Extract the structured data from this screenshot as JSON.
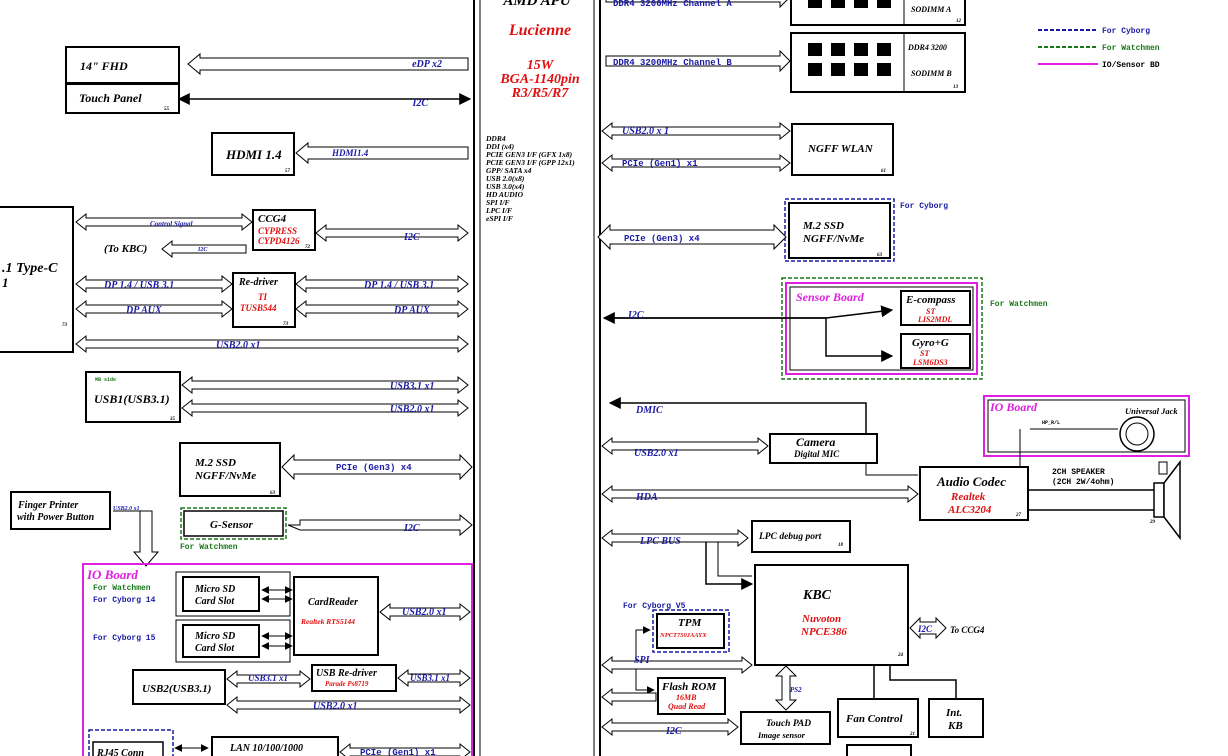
{
  "apu": {
    "title": "AMD APU",
    "codename": "Lucienne",
    "spec_lines": [
      "15W",
      "BGA-1140pin",
      "R3/R5/R7"
    ],
    "interfaces": [
      "DDR4",
      "DDI (x4)",
      "PCIE GEN3 I/F (GFX 1x8)",
      "PCIE GEN3 I/F (GPP 12x1)",
      "GPP/ SATA x4",
      "USB 2.0(x8)",
      "USB 3.0(x4)",
      "HD AUDIO",
      "SPI I/F",
      "LPC I/F",
      "eSPI I/F"
    ]
  },
  "legend": {
    "items": [
      {
        "label": "For Cyborg",
        "color": "#1a1aa6"
      },
      {
        "label": "For Watchmen",
        "color": "#1a7a1a"
      },
      {
        "label": "IO/Sensor BD",
        "color": "#e020e0"
      }
    ]
  },
  "left": {
    "fhd": {
      "title": "14\" FHD",
      "bus": "eDP x2"
    },
    "touch": {
      "title": "Touch Panel",
      "num": "55",
      "bus": "I2C"
    },
    "hdmi": {
      "title": "HDMI 1.4",
      "num": "57",
      "bus": "HDMI1.4"
    },
    "typec": {
      "line1": ".1  Type-C",
      "line2": "1",
      "num": "73"
    },
    "ccg4": {
      "title": "CCG4",
      "vendor": "CYPRESS",
      "part": "CYPD4126",
      "num": "72",
      "bus": "I2C",
      "control": "Control Signal",
      "kbc_label": "(To KBC)",
      "kbc_bus": "I2C"
    },
    "redriver": {
      "title": "Re-driver",
      "vendor": "TI",
      "part": "TUSB544",
      "num": "73",
      "dp_left": "DP 1.4 / USB 3.1",
      "aux_left": "DP AUX",
      "dp_right": "DP 1.4 / USB 3.1",
      "aux_right": "DP AUX"
    },
    "typec_usb2": "USB2.0 x1",
    "usb1": {
      "tag": "MB side",
      "title": "USB1(USB3.1)",
      "num": "35",
      "bus1": "USB3.1 x1",
      "bus2": "USB2.0 x1"
    },
    "ssd": {
      "line1": "M.2 SSD",
      "line2": "NGFF/NvMe",
      "num": "63",
      "bus": "PCIe (Gen3) x4"
    },
    "finger": {
      "line1": "Finger Printer",
      "line2": "with Power Button",
      "bus": "USB2.0 x1"
    },
    "gsensor": {
      "title": "G-Sensor",
      "note": "For Watchmen",
      "bus": "I2C"
    },
    "ioboard": {
      "title": "IO Board",
      "note1": "For Watchmen",
      "note2": "For Cyborg 14",
      "note3": "For Cyborg 15",
      "sd1": [
        "Micro SD",
        "Card Slot"
      ],
      "sd2": [
        "Micro SD",
        "Card Slot"
      ],
      "cardreader": {
        "title": "CardReader",
        "part": "Realtek RTS5144",
        "bus": "USB2.0 x1"
      },
      "usb2": {
        "title": "USB2(USB3.1)",
        "bus1": "USB3.1 x1",
        "bus2": "USB3.1 x1",
        "bus3": "USB2.0 x1"
      },
      "usbredriver": {
        "title": "USB Re-driver",
        "part": "Parade Ps8719"
      }
    },
    "rj45": {
      "title": "RJ45 Conn",
      "lan": "LAN 10/100/1000",
      "bus": "PCIe (Gen1) x1"
    }
  },
  "right": {
    "ddr_a": {
      "bus": "DDR4 3200MHz Channel A",
      "label": "SODIMM A",
      "num": "12"
    },
    "ddr_b": {
      "bus": "DDR4 3200MHz Channel B",
      "label": "SODIMM B",
      "num": "13",
      "speed": "DDR4 3200"
    },
    "wlan": {
      "title": "NGFF WLAN",
      "num": "61",
      "bus1": "USB2.0 x 1",
      "bus2": "PCIe (Gen1) x1"
    },
    "ssd": {
      "line1": "M.2 SSD",
      "line2": "NGFF/NvMe",
      "num": "63",
      "bus": "PCIe (Gen3) x4",
      "note": "For Cyborg"
    },
    "sensor": {
      "title": "Sensor Board",
      "bus": "I2C",
      "note": "For Watchmen",
      "ecompass": {
        "title": "E-compass",
        "vendor": "ST",
        "part": "LIS2MDL"
      },
      "gyro": {
        "title": "Gyro+G",
        "vendor": "ST",
        "part": "LSM6DS3"
      }
    },
    "ioboard": {
      "title": "IO Board",
      "hp": "HP_R/L",
      "jack": "Universal Jack"
    },
    "camera": {
      "title": "Camera",
      "sub": "Digital MIC",
      "bus1": "DMIC",
      "bus2": "USB2.0 x1"
    },
    "audio": {
      "title": "Audio Codec",
      "vendor": "Realtek",
      "part": "ALC3204",
      "num": "27",
      "bus": "HDA",
      "spk1": "2CH SPEAKER",
      "spk2": "(2CH 2W/4ohm)",
      "spknum": "29"
    },
    "lpcdbg": {
      "title": "LPC debug port",
      "num": "18",
      "bus": "LPC BUS"
    },
    "kbc": {
      "title": "KBC",
      "vendor": "Nuvoton",
      "part": "NPCE386",
      "num": "24",
      "i2c": "I2C",
      "ccg": "To CCG4"
    },
    "tpm": {
      "title": "TPM",
      "part": "NPCT750JAAYX",
      "note": "For Cyborg V5"
    },
    "spi": "SPI",
    "flash": {
      "title": "Flash ROM",
      "size": "16MB",
      "mode": "Quad Read"
    },
    "ps2": "PS2",
    "touchpad": {
      "title": "Touch PAD",
      "sub": "Image sensor",
      "bus": "I2C"
    },
    "fan": {
      "title": "Fan Control",
      "num": "21"
    },
    "kb": {
      "line1": "Int.",
      "line2": "KB"
    }
  }
}
